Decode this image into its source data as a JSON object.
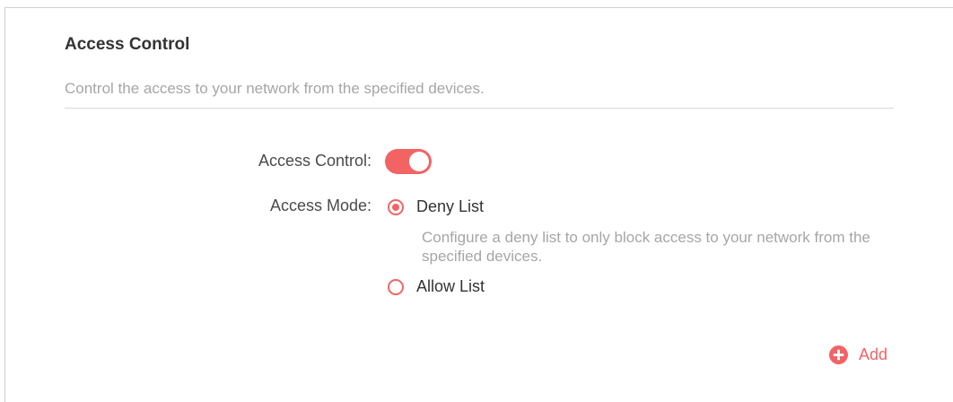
{
  "section": {
    "title": "Access Control",
    "description": "Control the access to your network from the specified devices."
  },
  "form": {
    "access_control_label": "Access Control:",
    "access_control_enabled": true,
    "access_mode_label": "Access Mode:",
    "access_mode_selected": "Deny List",
    "options": [
      {
        "label": "Deny List",
        "checked": true,
        "description": "Configure a deny list to only block access to your network from the specified devices."
      },
      {
        "label": "Allow List",
        "checked": false
      }
    ]
  },
  "actions": {
    "add_label": "Add",
    "add_icon": "plus-circle-icon"
  },
  "colors": {
    "accent": "#f26464",
    "heading": "#333333",
    "label": "#4a4a4a",
    "muted": "#a6a6a6",
    "divider": "#d9d9d9"
  }
}
